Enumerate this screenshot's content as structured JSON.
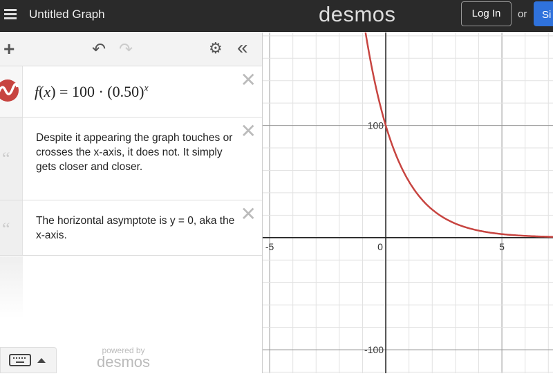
{
  "header": {
    "title": "Untitled Graph",
    "logo": "desmos",
    "login": "Log In",
    "or": "or",
    "signup": "Sign Up"
  },
  "toolbar": {
    "icons": [
      "plus-icon",
      "undo-icon",
      "redo-icon",
      "gear-icon",
      "collapse-icon"
    ]
  },
  "expressions": [
    {
      "type": "function",
      "lhs": "f",
      "var": "x",
      "eq": "=",
      "coef": "100",
      "dot": "·",
      "base": "(0.50)",
      "exp": "x",
      "color": "#c74440"
    },
    {
      "type": "note",
      "text": "Despite it appearing the graph touches or crosses the x-axis, it does not. It simply gets closer and closer."
    },
    {
      "type": "note",
      "text": "The horizontal asymptote is y = 0, aka the x-axis."
    }
  ],
  "footer": {
    "powered_by": "powered by",
    "brand": "desmos"
  },
  "chart_data": {
    "type": "line",
    "function": "f(x) = 100·(0.50)^x",
    "series": [
      {
        "color": "#c74440",
        "formula": "100*0.5^x"
      }
    ],
    "xlim": [
      -5.3,
      7.2
    ],
    "ylim": [
      -121,
      183
    ],
    "x_ticks": [
      "-5",
      "0",
      "5"
    ],
    "y_ticks": [
      "100",
      "-100"
    ],
    "grid": true
  }
}
